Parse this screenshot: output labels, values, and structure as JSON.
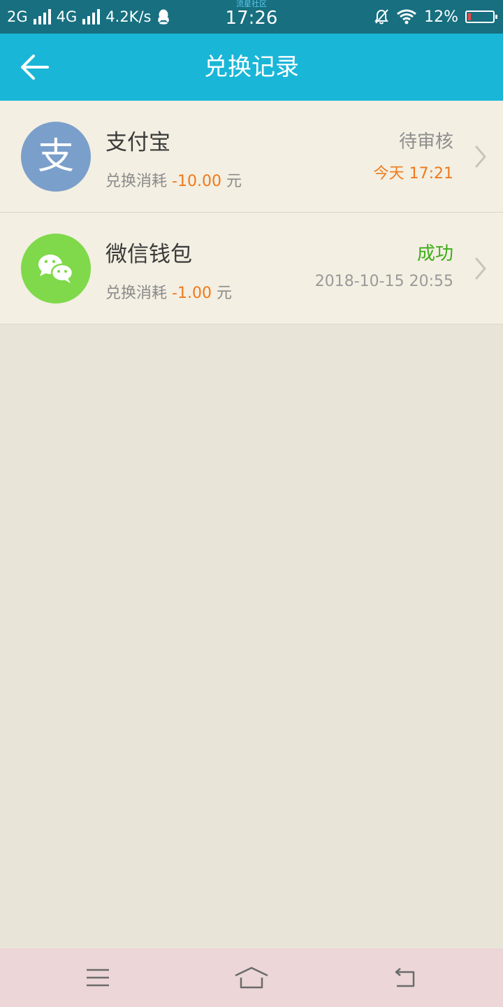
{
  "status_bar": {
    "network1": "2G",
    "network2": "4G",
    "speed": "4.2K/s",
    "carrier": "流星社区",
    "time": "17:26",
    "battery": "12%",
    "battery_level": 0.12
  },
  "header": {
    "title": "兑换记录"
  },
  "records": [
    {
      "name": "支付宝",
      "icon_glyph": "支",
      "icon": "alipay-icon",
      "icon_color": "#7b9fcb",
      "cost_label": "兑换消耗",
      "amount": "-10.00",
      "unit": "元",
      "status": "待审核",
      "status_color": "#8e8e8e",
      "time": "今天 17:21",
      "time_color": "#ef7a1c"
    },
    {
      "name": "微信钱包",
      "icon": "wechat-icon",
      "icon_color": "#7fd94a",
      "cost_label": "兑换消耗",
      "amount": "-1.00",
      "unit": "元",
      "status": "成功",
      "status_color": "#3fac1a",
      "time": "2018-10-15 20:55",
      "time_color": "#9a9a9a"
    }
  ],
  "colors": {
    "status_bar": "#176f7f",
    "title_bar": "#1ab6d7",
    "list_bg": "#f3efe2",
    "page_bg": "#e8e5d8",
    "amount": "#ef7a1c",
    "nav_bar": "#ecd6d8"
  }
}
